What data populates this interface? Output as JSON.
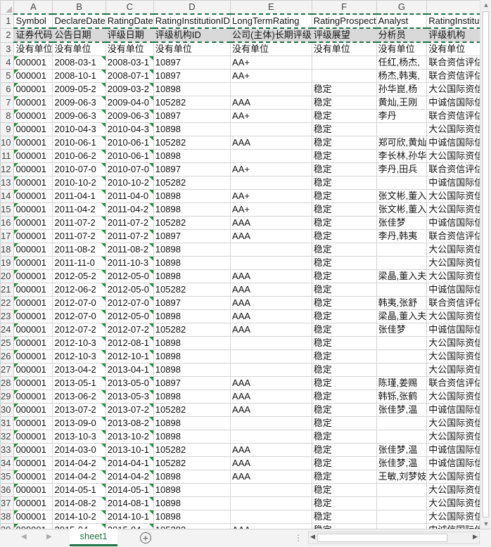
{
  "columns": [
    "A",
    "B",
    "C",
    "D",
    "E",
    "F",
    "G",
    "H",
    "I"
  ],
  "rows": [
    {
      "n": "1",
      "c": [
        "Symbol",
        "DeclareDate",
        "RatingDate",
        "RatingInstitutionID",
        "LongTermRating",
        "RatingProspect",
        "Analyst",
        "RatingInstitution",
        ""
      ]
    },
    {
      "n": "2",
      "c": [
        "证券代码",
        "公告日期",
        "评级日期",
        "评级机构ID",
        "公司(主体)长期评级",
        "评级展望",
        "分析员",
        "评级机构",
        ""
      ]
    },
    {
      "n": "3",
      "c": [
        "没有单位",
        "没有单位",
        "没有单位",
        "没有单位",
        "没有单位",
        "没有单位",
        "没有单位",
        "没有单位",
        ""
      ]
    },
    {
      "n": "4",
      "c": [
        "000001",
        "2008-03-1",
        "2008-03-1",
        "10897",
        "AA+",
        "",
        "任红,杨杰,",
        "联合资信评估有限公司",
        ""
      ]
    },
    {
      "n": "5",
      "c": [
        "000001",
        "2008-10-1",
        "2008-07-1",
        "10897",
        "AA+",
        "",
        "杨杰,韩夷,",
        "联合资信评估有限公司",
        ""
      ]
    },
    {
      "n": "6",
      "c": [
        "000001",
        "2009-05-2",
        "2009-03-2",
        "10898",
        "",
        "稳定",
        "孙华崑,杨",
        "大公国际资信评估有限公司",
        ""
      ]
    },
    {
      "n": "7",
      "c": [
        "000001",
        "2009-06-3",
        "2009-04-0",
        "105282",
        "AAA",
        "稳定",
        "黄灿,王刚",
        "中诚信国际信用评级有限责任公司",
        ""
      ]
    },
    {
      "n": "8",
      "c": [
        "000001",
        "2009-06-3",
        "2009-06-3",
        "10897",
        "AA+",
        "稳定",
        "李丹",
        "联合资信评估有限公司",
        ""
      ]
    },
    {
      "n": "9",
      "c": [
        "000001",
        "2010-04-3",
        "2010-04-3",
        "10898",
        "",
        "稳定",
        "",
        "大公国际资信评估有限公司",
        ""
      ]
    },
    {
      "n": "10",
      "c": [
        "000001",
        "2010-06-1",
        "2010-06-1",
        "105282",
        "AAA",
        "稳定",
        "郑可欣,黄灿",
        "中诚信国际信用评级有限责任公司",
        ""
      ]
    },
    {
      "n": "11",
      "c": [
        "000001",
        "2010-06-2",
        "2010-06-1",
        "10898",
        "",
        "稳定",
        "李长林,孙华",
        "大公国际资信评估有限公司",
        ""
      ]
    },
    {
      "n": "12",
      "c": [
        "000001",
        "2010-07-0",
        "2010-07-0",
        "10897",
        "AA+",
        "稳定",
        "李丹,田兵",
        "联合资信评估有限公司",
        ""
      ]
    },
    {
      "n": "13",
      "c": [
        "000001",
        "2010-10-2",
        "2010-10-2",
        "105282",
        "",
        "稳定",
        "",
        "中诚信国际信用评级有限责任公司",
        ""
      ]
    },
    {
      "n": "14",
      "c": [
        "000001",
        "2011-04-1",
        "2011-04-0",
        "10898",
        "AA+",
        "稳定",
        "张文彬,董入",
        "大公国际资信评估有限公司",
        ""
      ]
    },
    {
      "n": "15",
      "c": [
        "000001",
        "2011-04-2",
        "2011-04-2",
        "10898",
        "AA+",
        "稳定",
        "张文彬,董入",
        "大公国际资信评估有限公司",
        ""
      ]
    },
    {
      "n": "16",
      "c": [
        "000001",
        "2011-07-2",
        "2011-07-2",
        "105282",
        "AAA",
        "稳定",
        "张佳梦",
        "中诚信国际信用评级有限责任公司",
        ""
      ]
    },
    {
      "n": "17",
      "c": [
        "000001",
        "2011-07-2",
        "2011-07-2",
        "10897",
        "AAA",
        "稳定",
        "李丹,韩夷",
        "联合资信评估有限公司",
        ""
      ]
    },
    {
      "n": "18",
      "c": [
        "000001",
        "2011-08-2",
        "2011-08-2",
        "10898",
        "",
        "稳定",
        "",
        "大公国际资信评估有限公司",
        ""
      ]
    },
    {
      "n": "19",
      "c": [
        "000001",
        "2011-11-0",
        "2011-10-3",
        "10898",
        "",
        "稳定",
        "",
        "大公国际资信评估有限公司",
        ""
      ]
    },
    {
      "n": "20",
      "c": [
        "000001",
        "2012-05-2",
        "2012-05-0",
        "10898",
        "AAA",
        "稳定",
        "梁晶,董入夫",
        "大公国际资信评估有限公司",
        ""
      ]
    },
    {
      "n": "21",
      "c": [
        "000001",
        "2012-06-2",
        "2012-05-0",
        "105282",
        "AAA",
        "稳定",
        "",
        "中诚信国际信用评级有限责任公司",
        ""
      ]
    },
    {
      "n": "22",
      "c": [
        "000001",
        "2012-07-0",
        "2012-07-0",
        "10897",
        "AAA",
        "稳定",
        "韩夷,张舒",
        "联合资信评估有限公司",
        ""
      ]
    },
    {
      "n": "23",
      "c": [
        "000001",
        "2012-07-0",
        "2012-05-0",
        "10898",
        "AAA",
        "稳定",
        "梁晶,董入夫",
        "大公国际资信评估有限公司",
        ""
      ]
    },
    {
      "n": "24",
      "c": [
        "000001",
        "2012-07-2",
        "2012-07-2",
        "105282",
        "AAA",
        "稳定",
        "张佳梦",
        "中诚信国际信用评级有限责任公司",
        ""
      ]
    },
    {
      "n": "25",
      "c": [
        "000001",
        "2012-10-3",
        "2012-08-1",
        "10898",
        "",
        "稳定",
        "",
        "大公国际资信评估有限公司",
        ""
      ]
    },
    {
      "n": "26",
      "c": [
        "000001",
        "2012-10-3",
        "2012-10-1",
        "10898",
        "",
        "稳定",
        "",
        "大公国际资信评估有限公司",
        ""
      ]
    },
    {
      "n": "27",
      "c": [
        "000001",
        "2013-04-2",
        "2013-04-1",
        "10898",
        "",
        "稳定",
        "",
        "大公国际资信评估有限公司",
        ""
      ]
    },
    {
      "n": "28",
      "c": [
        "000001",
        "2013-05-1",
        "2013-05-0",
        "10897",
        "AAA",
        "稳定",
        "陈瑾,姜赐",
        "联合资信评估有限公司",
        ""
      ]
    },
    {
      "n": "29",
      "c": [
        "000001",
        "2013-06-2",
        "2013-05-3",
        "10898",
        "AAA",
        "稳定",
        "韩铄,张鹤",
        "大公国际资信评估有限公司",
        ""
      ]
    },
    {
      "n": "30",
      "c": [
        "000001",
        "2013-07-2",
        "2013-07-2",
        "105282",
        "AAA",
        "稳定",
        "张佳梦,温",
        "中诚信国际信用评级有限责任公司",
        ""
      ]
    },
    {
      "n": "31",
      "c": [
        "000001",
        "2013-09-0",
        "2013-08-2",
        "10898",
        "",
        "稳定",
        "",
        "大公国际资信评估有限公司",
        ""
      ]
    },
    {
      "n": "32",
      "c": [
        "000001",
        "2013-10-3",
        "2013-10-2",
        "10898",
        "",
        "稳定",
        "",
        "大公国际资信评估有限公司",
        ""
      ]
    },
    {
      "n": "33",
      "c": [
        "000001",
        "2014-03-0",
        "2013-10-1",
        "105282",
        "AAA",
        "稳定",
        "张佳梦,温",
        "中诚信国际信用评级有限责任公司",
        ""
      ]
    },
    {
      "n": "34",
      "c": [
        "000001",
        "2014-04-2",
        "2014-04-1",
        "105282",
        "AAA",
        "稳定",
        "张佳梦,温",
        "中诚信国际信用评级有限责任公司",
        ""
      ]
    },
    {
      "n": "35",
      "c": [
        "000001",
        "2014-04-2",
        "2014-04-2",
        "10898",
        "AAA",
        "稳定",
        "王敏,刘梦妓",
        "大公国际资信评估有限公司",
        ""
      ]
    },
    {
      "n": "36",
      "c": [
        "000001",
        "2014-05-1",
        "2014-05-1",
        "10898",
        "",
        "稳定",
        "",
        "大公国际资信评估有限公司",
        ""
      ]
    },
    {
      "n": "37",
      "c": [
        "000001",
        "2014-08-2",
        "2014-08-1",
        "10898",
        "",
        "稳定",
        "",
        "大公国际资信评估有限公司",
        ""
      ]
    },
    {
      "n": "38",
      "c": [
        "000001",
        "2014-10-2",
        "2014-10-1",
        "10898",
        "",
        "稳定",
        "",
        "大公国际资信评估有限公司",
        ""
      ]
    },
    {
      "n": "39",
      "c": [
        "000001",
        "2015-04-",
        "2015-04-",
        "105282",
        "AAA",
        "稳定",
        "",
        "中诚信国际信用评级有限责任公司",
        ""
      ]
    }
  ],
  "sheet_tab": "sheet1",
  "add_sheet_symbol": "+",
  "colors": {
    "accent": "#217346",
    "marker": "#1e8c3c",
    "selection_dash": "#1e7145"
  }
}
